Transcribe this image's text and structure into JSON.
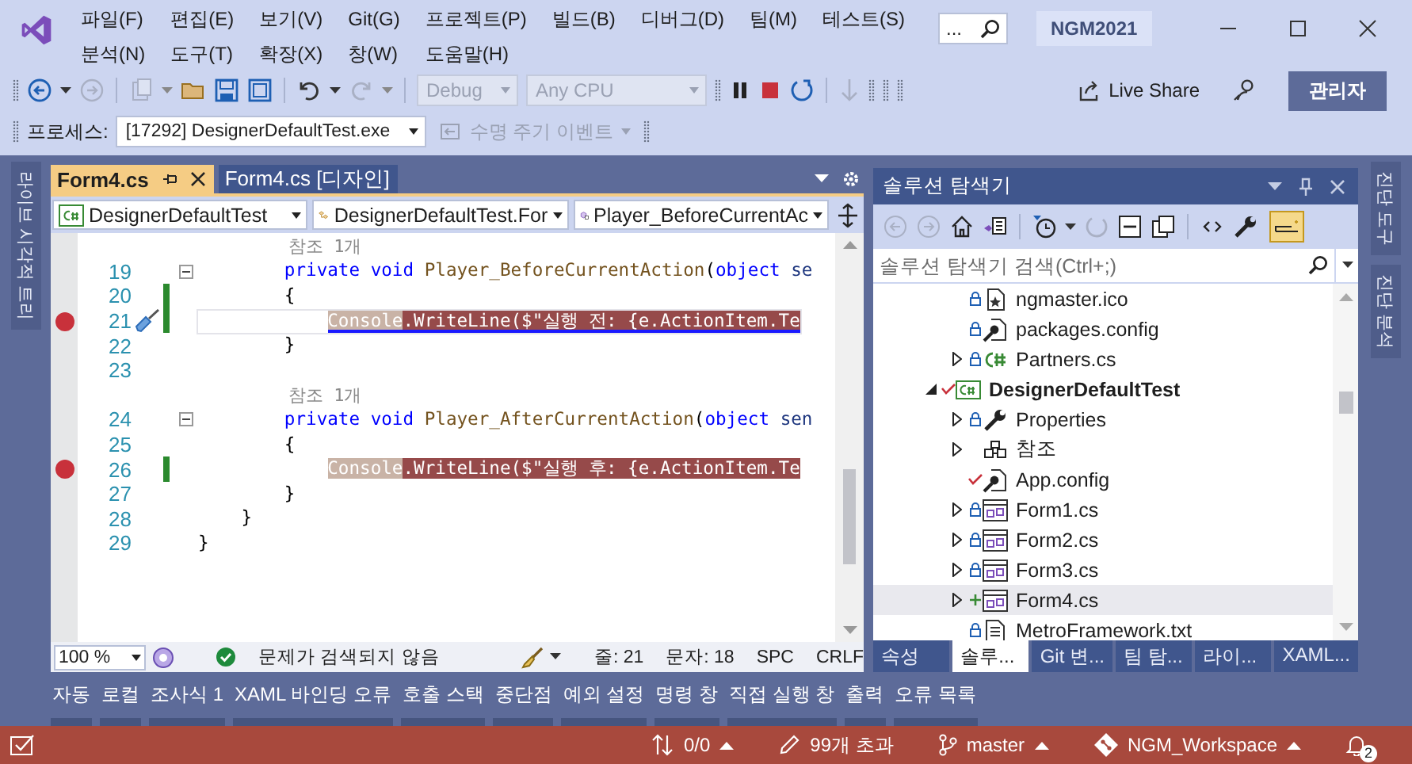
{
  "menu": [
    {
      "label": "파일(F)"
    },
    {
      "label": "편집(E)"
    },
    {
      "label": "보기(V)"
    },
    {
      "label": "Git(G)"
    },
    {
      "label": "프로젝트(P)"
    },
    {
      "label": "빌드(B)"
    },
    {
      "label": "디버그(D)"
    },
    {
      "label": "팀(M)"
    },
    {
      "label": "테스트(S)"
    },
    {
      "label": "분석(N)"
    },
    {
      "label": "도구(T)"
    },
    {
      "label": "확장(X)"
    },
    {
      "label": "창(W)"
    },
    {
      "label": "도움말(H)"
    }
  ],
  "search": {
    "text": "..."
  },
  "window": {
    "title": "NGM2021"
  },
  "toolbar": {
    "configuration": {
      "value": "Debug",
      "disabled": true
    },
    "platform": {
      "value": "Any CPU",
      "disabled": true
    },
    "live_share": "Live Share",
    "account_button": "관리자"
  },
  "process_bar": {
    "label": "프로세스:",
    "process": "[17292] DesignerDefaultTest.exe",
    "lifecycle_events": {
      "label": "수명 주기 이벤트",
      "disabled": true
    }
  },
  "left_panel_tabs": [
    {
      "label": "라이브 시각적 트리"
    }
  ],
  "editor": {
    "tabs": [
      {
        "label": "Form4.cs",
        "selected": true
      },
      {
        "label": "Form4.cs [디자인]",
        "selected": false
      }
    ],
    "navigation": [
      {
        "kind": "project",
        "label": "DesignerDefaultTest"
      },
      {
        "kind": "class",
        "label": "DesignerDefaultTest.For"
      },
      {
        "kind": "method",
        "label": "Player_BeforeCurrentAc"
      }
    ],
    "lines": [
      {
        "kind": "codelens",
        "text": "참조 1개"
      },
      {
        "kind": "code",
        "number": "19",
        "breakpoint": false,
        "changed": false,
        "current": false,
        "quick_action": false,
        "fold": {
          "expanded": true
        },
        "tokens": [
          {
            "kind": "keyword",
            "text": "        private void"
          },
          {
            "kind": "method",
            "text": " Player_BeforeCurrentAction"
          },
          {
            "kind": "plain",
            "text": "("
          },
          {
            "kind": "keyword",
            "text": "object"
          },
          {
            "kind": "param",
            "text": " se"
          }
        ]
      },
      {
        "kind": "code",
        "number": "20",
        "breakpoint": false,
        "changed": true,
        "current": false,
        "quick_action": false,
        "tokens": [
          {
            "kind": "plain",
            "text": "        {"
          }
        ]
      },
      {
        "kind": "code",
        "number": "21",
        "breakpoint": true,
        "changed": true,
        "current": true,
        "quick_action": true,
        "tokens": [
          {
            "kind": "reference",
            "text": "            Console"
          },
          {
            "kind": "plain",
            "text": ".WriteLine($\"실행 전: {e.ActionItem.Te"
          }
        ]
      },
      {
        "kind": "code",
        "number": "22",
        "breakpoint": false,
        "changed": false,
        "current": false,
        "quick_action": false,
        "tokens": [
          {
            "kind": "plain",
            "text": "        }"
          }
        ]
      },
      {
        "kind": "code",
        "number": "23",
        "breakpoint": false,
        "changed": false,
        "current": false,
        "quick_action": false
      },
      {
        "kind": "codelens",
        "text": "참조 1개"
      },
      {
        "kind": "code",
        "number": "24",
        "breakpoint": false,
        "changed": false,
        "current": false,
        "quick_action": false,
        "fold": {
          "expanded": true
        },
        "tokens": [
          {
            "kind": "keyword",
            "text": "        private void"
          },
          {
            "kind": "method",
            "text": " Player_AfterCurrentAction"
          },
          {
            "kind": "plain",
            "text": "("
          },
          {
            "kind": "keyword",
            "text": "object"
          },
          {
            "kind": "param",
            "text": " sen"
          }
        ]
      },
      {
        "kind": "code",
        "number": "25",
        "breakpoint": false,
        "changed": false,
        "current": false,
        "quick_action": false,
        "tokens": [
          {
            "kind": "plain",
            "text": "        {"
          }
        ]
      },
      {
        "kind": "code",
        "number": "26",
        "breakpoint": true,
        "changed": true,
        "current": false,
        "quick_action": false,
        "tokens": [
          {
            "kind": "reference",
            "text": "            Console"
          },
          {
            "kind": "plain",
            "text": ".WriteLine($\"실행 후: {e.ActionItem.Te"
          }
        ]
      },
      {
        "kind": "code",
        "number": "27",
        "breakpoint": false,
        "changed": false,
        "current": false,
        "quick_action": false,
        "tokens": [
          {
            "kind": "plain",
            "text": "        }"
          }
        ]
      },
      {
        "kind": "code",
        "number": "28",
        "breakpoint": false,
        "changed": false,
        "current": false,
        "quick_action": false,
        "tokens": [
          {
            "kind": "plain",
            "text": "    }"
          }
        ]
      },
      {
        "kind": "code",
        "number": "29",
        "breakpoint": false,
        "changed": false,
        "current": false,
        "quick_action": false,
        "tokens": [
          {
            "kind": "plain",
            "text": "}"
          }
        ]
      }
    ],
    "status": {
      "zoom": "100 %",
      "issues": "문제가 검색되지 않음",
      "line": "줄: 21",
      "column": "문자: 18",
      "whitespace": "SPC",
      "line_ending": "CRLF"
    }
  },
  "solution_explorer": {
    "title": "솔루션 탐색기",
    "search": {
      "placeholder": "솔루션 탐색기 검색(Ctrl+;)"
    },
    "continued_items": [
      {
        "label": "ngmaster.ico",
        "kind": "image",
        "locked": true,
        "checked_out": false,
        "added": false,
        "selected": false
      },
      {
        "label": "packages.config",
        "kind": "config",
        "locked": true,
        "checked_out": false,
        "added": false,
        "selected": false
      },
      {
        "label": "Partners.cs",
        "kind": "csharp",
        "locked": true,
        "checked_out": false,
        "added": false,
        "expanded": false,
        "selected": false
      }
    ],
    "items": [
      {
        "label": "DesignerDefaultTest",
        "kind": "project",
        "locked": false,
        "checked_out": true,
        "added": false,
        "expanded": true,
        "selected": false,
        "children": [
          {
            "label": "Properties",
            "kind": "wrench",
            "locked": true,
            "checked_out": false,
            "added": false,
            "expanded": false,
            "selected": false
          },
          {
            "label": "참조",
            "kind": "references",
            "locked": false,
            "checked_out": false,
            "added": false,
            "expanded": false,
            "selected": false
          },
          {
            "label": "App.config",
            "kind": "config",
            "locked": false,
            "checked_out": true,
            "added": false,
            "selected": false
          },
          {
            "label": "Form1.cs",
            "kind": "form",
            "locked": true,
            "checked_out": false,
            "added": false,
            "expanded": false,
            "selected": false
          },
          {
            "label": "Form2.cs",
            "kind": "form",
            "locked": true,
            "checked_out": false,
            "added": false,
            "expanded": false,
            "selected": false
          },
          {
            "label": "Form3.cs",
            "kind": "form",
            "locked": true,
            "checked_out": false,
            "added": false,
            "expanded": false,
            "selected": false
          },
          {
            "label": "Form4.cs",
            "kind": "form",
            "locked": false,
            "checked_out": false,
            "added": true,
            "expanded": false,
            "selected": true
          },
          {
            "label": "MetroFramework.txt",
            "kind": "text",
            "locked": true,
            "checked_out": false,
            "added": false,
            "selected": false
          }
        ]
      }
    ],
    "tabs": [
      {
        "label": "속성",
        "selected": false
      },
      {
        "label": "솔루...",
        "selected": true
      },
      {
        "label": "Git 변...",
        "selected": false
      },
      {
        "label": "팀 탐...",
        "selected": false
      },
      {
        "label": "라이...",
        "selected": false
      },
      {
        "label": "XAML...",
        "selected": false
      }
    ]
  },
  "right_panel_tabs": [
    {
      "label": "진단 도구"
    },
    {
      "label": "진단 분석"
    }
  ],
  "tool_tabs": [
    {
      "label": "자동"
    },
    {
      "label": "로컬"
    },
    {
      "label": "조사식 1"
    },
    {
      "label": "XAML 바인딩 오류"
    },
    {
      "label": "호출 스택"
    },
    {
      "label": "중단점"
    },
    {
      "label": "예외 설정"
    },
    {
      "label": "명령 창"
    },
    {
      "label": "직접 실행 창"
    },
    {
      "label": "출력"
    },
    {
      "label": "오류 목록"
    }
  ],
  "status_bar": {
    "changes": "0/0",
    "pending": "99개 초과",
    "branch": "master",
    "repository": "NGM_Workspace",
    "notifications": "2"
  }
}
